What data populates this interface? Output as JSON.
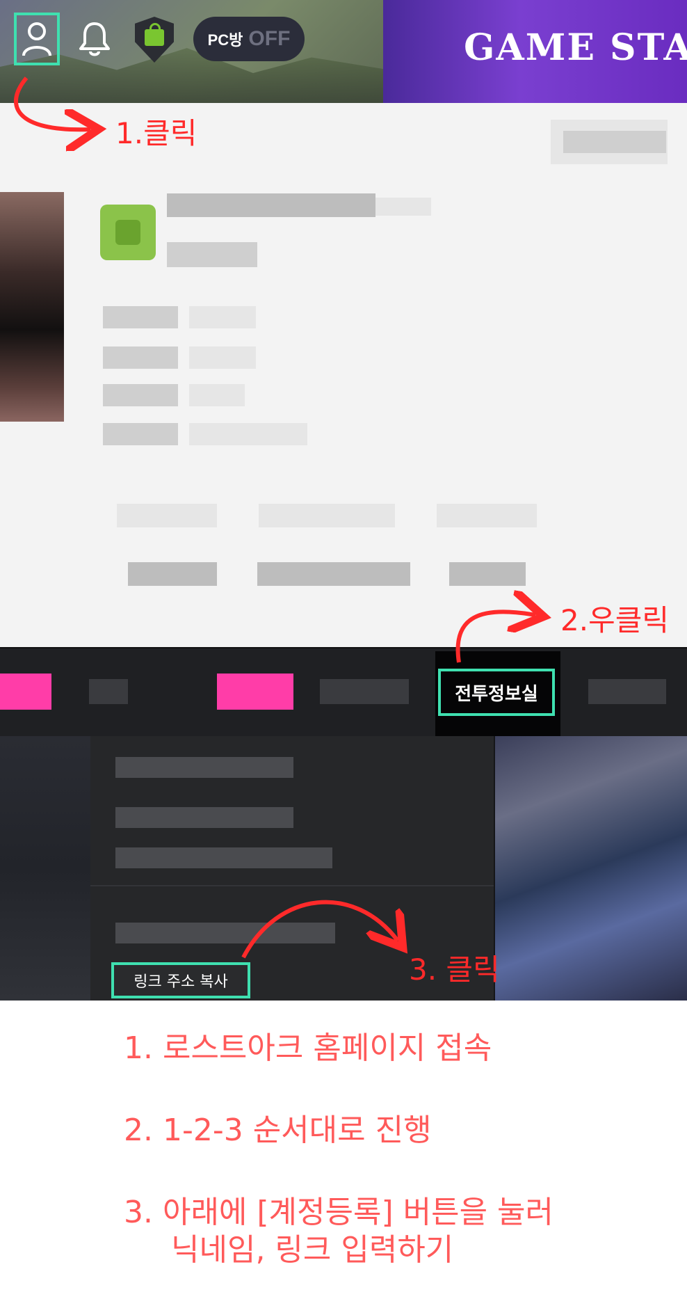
{
  "header": {
    "banner_text": "GAME STAR",
    "pc_label": "PC방",
    "pc_status": "OFF"
  },
  "nav": {
    "active_tab_label": "전투정보실"
  },
  "context_menu": {
    "copy_link_label": "링크 주소 복사"
  },
  "annotations": {
    "step1": "1.클릭",
    "step2": "2.우클릭",
    "step3": "3. 클릭"
  },
  "instructions": {
    "line1": "1. 로스트아크 홈페이지 접속",
    "line2": "2. 1-2-3 순서대로 진행",
    "line3a": "3. 아래에 [계정등록] 버튼을 눌러",
    "line3b": "닉네임, 링크 입력하기"
  },
  "colors": {
    "highlight": "#3fe0b0",
    "annotation": "#ff2a2a",
    "instruction": "#ff5a5a",
    "banner": "#6a2cc0"
  },
  "icons": [
    "user-icon",
    "bell-icon",
    "shop-icon"
  ]
}
